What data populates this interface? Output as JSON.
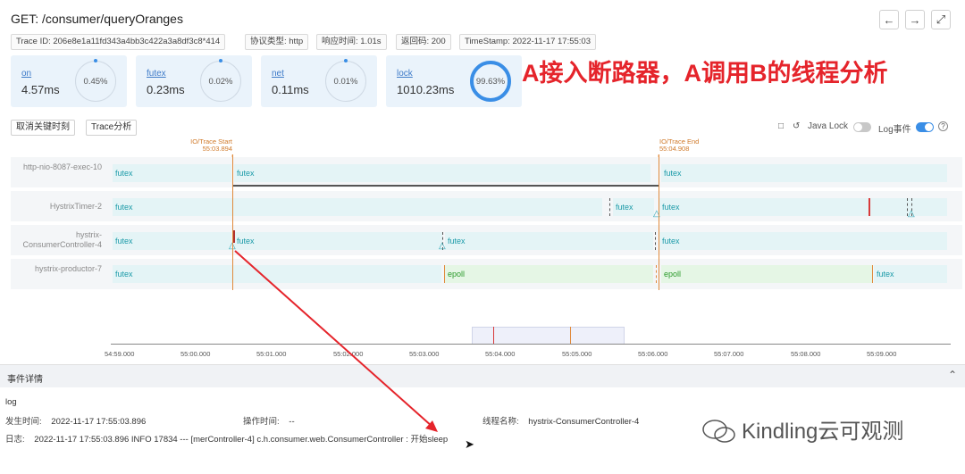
{
  "header": {
    "title": "GET: /consumer/queryOranges",
    "tags": [
      "Trace ID: 206e8e1a11fd343a4bb3c422a3a8df3c8*414",
      "协议类型: http",
      "响应时间: 1.01s",
      "返回码: 200",
      "TimeStamp: 2022-11-17 17:55:03"
    ]
  },
  "cards": [
    {
      "name": "on",
      "value": "4.57ms",
      "percent": "0.45%"
    },
    {
      "name": "futex",
      "value": "0.23ms",
      "percent": "0.02%"
    },
    {
      "name": "net",
      "value": "0.11ms",
      "percent": "0.01%"
    },
    {
      "name": "lock",
      "value": "1010.23ms",
      "percent": "99.63%"
    }
  ],
  "annotation": "A接入断路器，A调用B的线程分析",
  "toolbar": {
    "cancel_label": "取消关键时刻",
    "trace_label": "Trace分析",
    "java_lock_label": "Java Lock",
    "log_event_label": "Log事件",
    "colors": {
      "toggle_on": "#3a8ee6",
      "toggle_off": "#c8c8c8"
    }
  },
  "markers": {
    "start_label": "IO/Trace Start",
    "start_time": "55:03.894",
    "end_label": "IO/Trace End",
    "end_time": "55:04.908"
  },
  "lanes": [
    {
      "label": "http-nio-8087-exec-10",
      "bars": [
        "futex",
        "futex",
        "futex"
      ]
    },
    {
      "label": "HystrixTimer-2",
      "bars": [
        "futex",
        "futex",
        "futex"
      ]
    },
    {
      "label": "hystrix-ConsumerController-4",
      "bars": [
        "futex",
        "futex",
        "futex",
        "futex"
      ]
    },
    {
      "label": "hystrix-productor-7",
      "bars": [
        "futex",
        "epoll",
        "epoll",
        "futex"
      ]
    }
  ],
  "axis": {
    "ticks": [
      "54:59.000",
      "55:00.000",
      "55:01.000",
      "55:02.000",
      "55:03.000",
      "55:04.000",
      "55:05.000",
      "55:06.000",
      "55:07.000",
      "55:08.000",
      "55:09.000"
    ]
  },
  "event_detail": {
    "section_title": "事件详情",
    "type": "log",
    "occur_label": "发生时间:",
    "occur_value": "2022-11-17 17:55:03.896",
    "op_label": "操作时间:",
    "op_value": "--",
    "thread_label": "线程名称:",
    "thread_value": "hystrix-ConsumerController-4",
    "log_label": "日志:",
    "log_value": "2022-11-17 17:55:03.896 INFO 17834 --- [merController-4] c.h.consumer.web.ConsumerController : 开始sleep"
  },
  "watermark": "Kindling云可观测"
}
